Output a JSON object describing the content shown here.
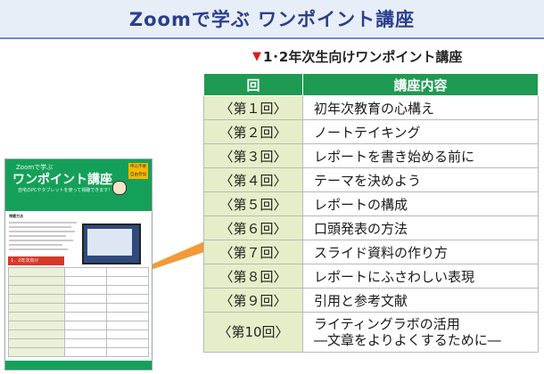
{
  "header": {
    "title": "Zoomで学ぶ ワンポイント講座"
  },
  "subheading": {
    "marker": "▼",
    "text": "1･2年次生向けワンポイント講座"
  },
  "table": {
    "headers": {
      "number": "回",
      "content": "講座内容"
    },
    "rows": [
      {
        "number": "〈第１回〉",
        "title": "初年次教育の心構え"
      },
      {
        "number": "〈第２回〉",
        "title": "ノートテイキング"
      },
      {
        "number": "〈第３回〉",
        "title": "レポートを書き始める前に"
      },
      {
        "number": "〈第４回〉",
        "title": "テーマを決めよう"
      },
      {
        "number": "〈第５回〉",
        "title": "レポートの構成"
      },
      {
        "number": "〈第６回〉",
        "title": "口頭発表の方法"
      },
      {
        "number": "〈第７回〉",
        "title": "スライド資料の作り方"
      },
      {
        "number": "〈第８回〉",
        "title": "レポートにふさわしい表現"
      },
      {
        "number": "〈第９回〉",
        "title": "引用と参考文献"
      },
      {
        "number": "〈第10回〉",
        "title": "ライティングラボの活用",
        "title2": "―文章をよりよくするために―"
      }
    ]
  },
  "flyer": {
    "small_title": "Zoomで学ぶ",
    "title": "ワンポイント講座",
    "subtitle": "自宅のPCやタブレットを使って視聴できます！",
    "badge": "申込不要 自由参加",
    "section": "視聴方法",
    "table_head": "1．2年次向け",
    "colors": {
      "green": "#15a05a",
      "red": "#d43a2a",
      "gold": "#f6b800"
    }
  },
  "colors": {
    "header_bg": "#e8eef7",
    "header_text": "#2b3f8f",
    "table_head": "#1f9a52",
    "number_cell": "#e4efc9",
    "connector": "#f29a36"
  }
}
